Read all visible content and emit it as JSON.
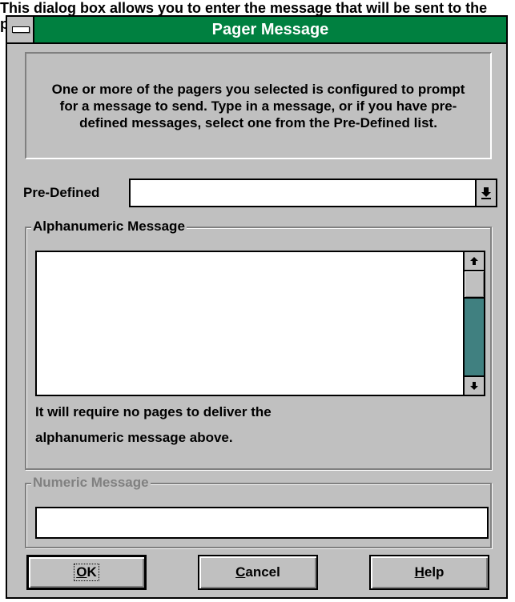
{
  "caption": "This dialog box allows you to enter the message that will be sent to the pager.",
  "window": {
    "title": "Pager Message"
  },
  "info_text": "One or more of the pagers you selected is configured to prompt for a message to send.  Type in a message, or if you have pre-defined messages, select one from the Pre-Defined list.",
  "predefined": {
    "label": "Pre-Defined",
    "value": "",
    "arrow_icon": "combo-dropdown-arrow"
  },
  "alpha": {
    "group_label": "Alphanumeric Message",
    "value": "",
    "pages_line1": "It will require no pages to deliver the",
    "pages_line2": "alphanumeric message above."
  },
  "numeric": {
    "group_label": "Numeric Message",
    "value": "",
    "disabled": true
  },
  "buttons": {
    "ok": {
      "prefix": "",
      "mnemonic": "O",
      "rest": "K"
    },
    "cancel": {
      "prefix": "",
      "mnemonic": "C",
      "rest": "ancel"
    },
    "help": {
      "prefix": "",
      "mnemonic": "H",
      "rest": "elp"
    }
  },
  "colors": {
    "titlebar": "#008040",
    "face": "#c0c0c0",
    "scroll_track": "#408080",
    "disabled_text": "#808080"
  }
}
